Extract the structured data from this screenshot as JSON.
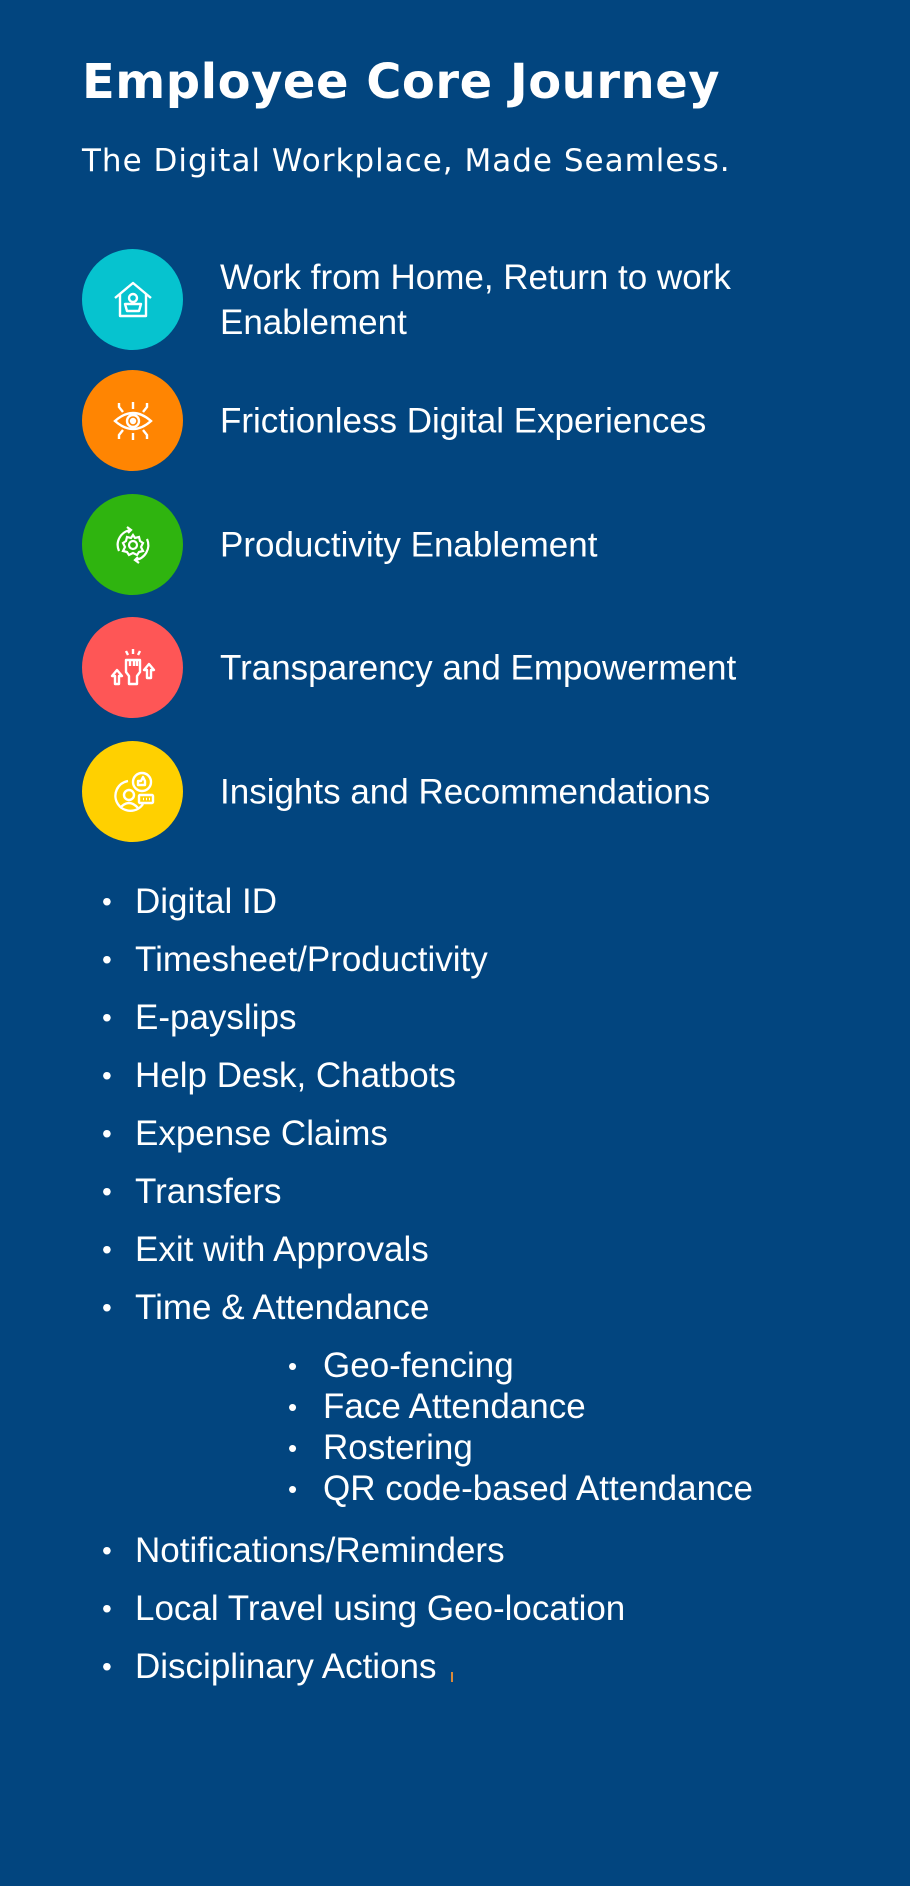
{
  "header": {
    "title": "Employee Core Journey",
    "subtitle": "The Digital Workplace, Made Seamless."
  },
  "features": [
    {
      "label": "Work from Home, Return to work Enablement",
      "icon": "home-worker-icon",
      "color": "#06C3CF"
    },
    {
      "label": "Frictionless Digital Experiences",
      "icon": "digital-eye-icon",
      "color": "#FF8502"
    },
    {
      "label": "Productivity Enablement",
      "icon": "gear-cycle-icon",
      "color": "#2FB40F"
    },
    {
      "label": "Transparency and Empowerment",
      "icon": "raised-fist-icon",
      "color": "#FE5656"
    },
    {
      "label": "Insights and Recommendations",
      "icon": "user-feedback-icon",
      "color": "#FFD000"
    }
  ],
  "bullet_symbol": "•",
  "bullets": [
    "Digital ID",
    "Timesheet/Productivity",
    "E-payslips",
    "Help Desk, Chatbots",
    "Expense Claims",
    "Transfers",
    "Exit with Approvals",
    "Time & Attendance"
  ],
  "sub_bullets": [
    "Geo-fencing",
    "Face Attendance",
    "Rostering",
    "QR code-based Attendance"
  ],
  "bullets_after": [
    "Notifications/Reminders",
    "Local Travel using Geo-location",
    "Disciplinary Actions"
  ],
  "colors": {
    "background": "#02457F",
    "text": "#FFFFFF"
  }
}
